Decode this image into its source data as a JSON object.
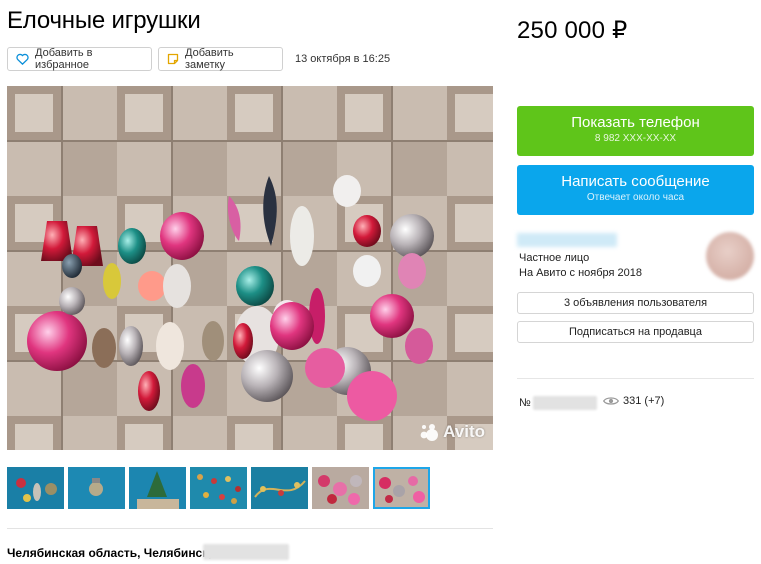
{
  "listing": {
    "title": "Елочные игрушки",
    "price": "250 000 ₽",
    "date": "13 октября в 16:25",
    "address_prefix": "Челябинская область, Челябинск,"
  },
  "actions": {
    "favorite_label": "Добавить в избранное",
    "note_label": "Добавить заметку"
  },
  "contact": {
    "phone_label": "Показать телефон",
    "phone_masked": "8 982 XXX-XX-XX",
    "message_label": "Написать сообщение",
    "message_sub": "Отвечает около часа"
  },
  "seller": {
    "type": "Частное лицо",
    "since": "На Авито с ноября 2018",
    "ads_button": "3 объявления пользователя",
    "subscribe_button": "Подписаться на продавца"
  },
  "stats": {
    "number_label": "№",
    "views": "331 (+7)"
  },
  "photo": {
    "watermark": "Avito",
    "thumbnail_count": 7,
    "active_thumbnail": 7
  },
  "colors": {
    "phone_button": "#5fc51a",
    "message_button": "#0aa6ec",
    "active_thumb_border": "#1ea6e8"
  },
  "icons": {
    "favorite": "heart-outline-icon",
    "note": "note-icon",
    "views": "eye-icon",
    "watermark": "avito-logo-icon"
  }
}
